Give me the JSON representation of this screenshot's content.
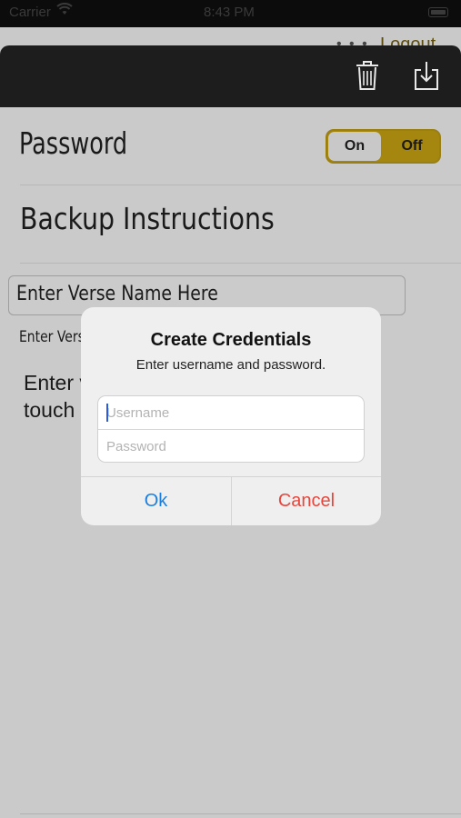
{
  "status_bar": {
    "carrier": "Carrier",
    "time": "8:43 PM"
  },
  "behind_nav": {
    "logout_label": "Logout"
  },
  "toolbar": {
    "trash_icon": "trash-icon",
    "download_icon": "download-icon"
  },
  "settings": {
    "password_label": "Password",
    "toggle": {
      "on_label": "On",
      "off_label": "Off",
      "selected": "On"
    },
    "backup_label": "Backup Instructions"
  },
  "form": {
    "verse_input_placeholder": "Enter Verse Name Here",
    "verse_caption": "Enter Verse",
    "instructions_line1": "Enter v",
    "instructions_line2": "touch"
  },
  "dialog": {
    "title": "Create Credentials",
    "message": "Enter username and password.",
    "username_placeholder": "Username",
    "password_placeholder": "Password",
    "ok_label": "Ok",
    "cancel_label": "Cancel"
  },
  "colors": {
    "accent_gold": "#a5860e",
    "ok_blue": "#1a7fe0",
    "cancel_red": "#e8463c"
  }
}
